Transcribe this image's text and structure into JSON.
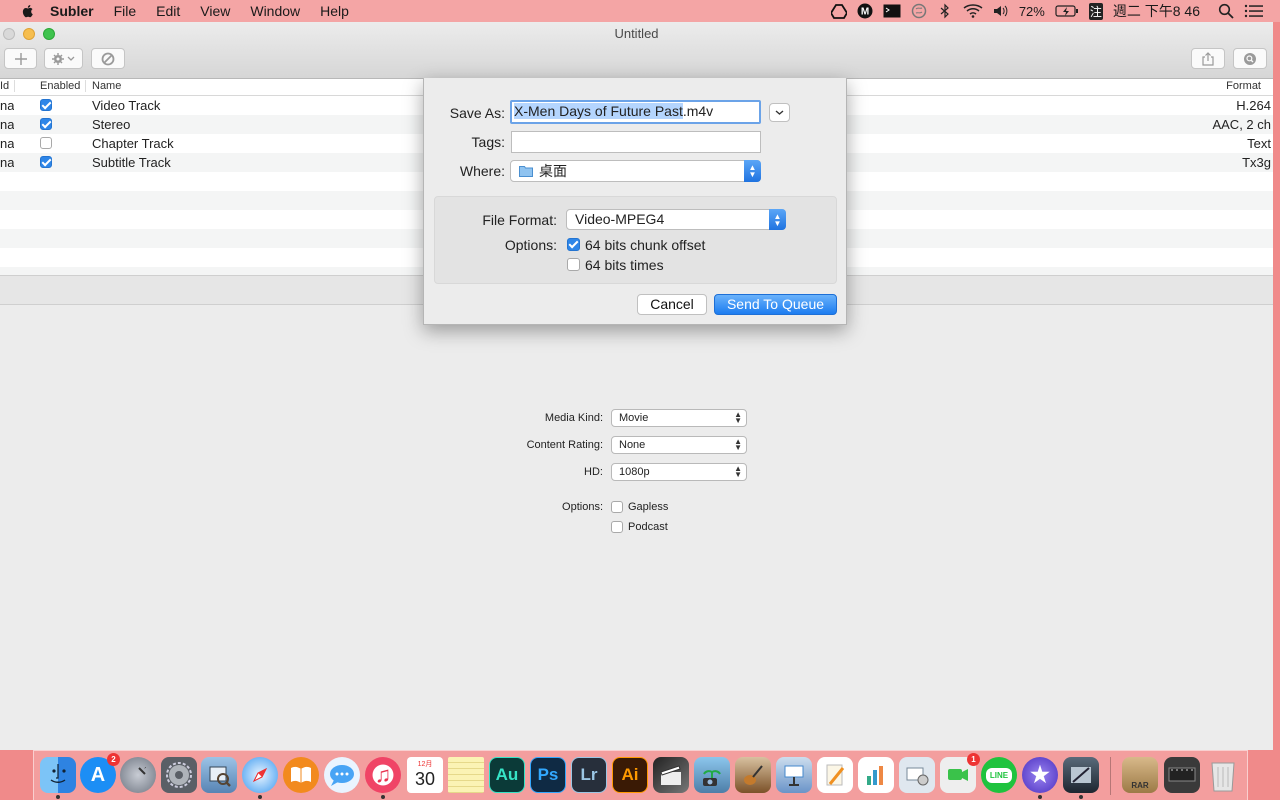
{
  "menubar": {
    "app_name": "Subler",
    "items": [
      "File",
      "Edit",
      "View",
      "Window",
      "Help"
    ],
    "battery": "72%",
    "input_method": "注",
    "clock": "週二 下午8 46"
  },
  "window": {
    "title": "Untitled"
  },
  "tracks": {
    "headers": {
      "id": "Id",
      "enabled": "Enabled",
      "name": "Name",
      "format": "Format"
    },
    "rows": [
      {
        "id": "na",
        "enabled": true,
        "name": "Video Track",
        "format": "H.264"
      },
      {
        "id": "na",
        "enabled": true,
        "name": "Stereo",
        "format": "AAC, 2 ch"
      },
      {
        "id": "na",
        "enabled": false,
        "name": "Chapter Track",
        "format": "Text"
      },
      {
        "id": "na",
        "enabled": true,
        "name": "Subtitle Track",
        "format": "Tx3g"
      }
    ]
  },
  "metadata": {
    "media_kind_label": "Media Kind:",
    "media_kind": "Movie",
    "content_rating_label": "Content Rating:",
    "content_rating": "None",
    "hd_label": "HD:",
    "hd": "1080p",
    "options_label": "Options:",
    "gapless": "Gapless",
    "podcast": "Podcast"
  },
  "save_sheet": {
    "save_as_label": "Save As:",
    "filename_selected": "X-Men Days of Future Past",
    "filename_ext": ".m4v",
    "tags_label": "Tags:",
    "tags_value": "",
    "where_label": "Where:",
    "where_value": "桌面",
    "file_format_label": "File Format:",
    "file_format": "Video-MPEG4",
    "options_label": "Options:",
    "opt_chunk": "64 bits chunk offset",
    "opt_chunk_checked": true,
    "opt_times": "64 bits times",
    "opt_times_checked": false,
    "cancel": "Cancel",
    "send": "Send To Queue"
  },
  "dock": {
    "app_store_badge": "2",
    "calendar_day": "30",
    "calendar_month": "12月",
    "facetime_badge": "1",
    "apps": [
      {
        "name": "Finder",
        "label": "",
        "color": "#3a8ee6"
      },
      {
        "name": "App Store",
        "label": "A",
        "color": "#2a8ff0"
      },
      {
        "name": "Launchpad",
        "label": "",
        "color": "#8a8f99"
      },
      {
        "name": "System Preferences",
        "label": "",
        "color": "#777"
      },
      {
        "name": "Preview",
        "label": "",
        "color": "#6b8fb5"
      },
      {
        "name": "Safari",
        "label": "",
        "color": "#3b9af0"
      },
      {
        "name": "iBooks",
        "label": "",
        "color": "#f08a24"
      },
      {
        "name": "Messages",
        "label": "",
        "color": "#4aa3f0"
      },
      {
        "name": "iTunes",
        "label": "♫",
        "color": "#ef3c5c"
      },
      {
        "name": "Calendar",
        "label": "",
        "color": "#ffffff"
      },
      {
        "name": "Notes",
        "label": "",
        "color": "#f5e27a"
      },
      {
        "name": "Audition",
        "label": "Au",
        "color": "#0c3b3a"
      },
      {
        "name": "Photoshop",
        "label": "Ps",
        "color": "#0f2a44"
      },
      {
        "name": "Lightroom",
        "label": "Lr",
        "color": "#2a3240"
      },
      {
        "name": "Illustrator",
        "label": "Ai",
        "color": "#3a1a05"
      },
      {
        "name": "Final Cut Pro",
        "label": "",
        "color": "#444"
      },
      {
        "name": "iPhoto",
        "label": "",
        "color": "#6fa8d8"
      },
      {
        "name": "GarageBand",
        "label": "",
        "color": "#8a5a2a"
      },
      {
        "name": "Keynote",
        "label": "",
        "color": "#3d7fd1"
      },
      {
        "name": "Pages",
        "label": "",
        "color": "#f0a030"
      },
      {
        "name": "Numbers",
        "label": "",
        "color": "#3aa84a"
      },
      {
        "name": "Image Capture",
        "label": "",
        "color": "#c8d8e8"
      },
      {
        "name": "FaceTime",
        "label": "",
        "color": "#3ac24a"
      },
      {
        "name": "LINE",
        "label": "LINE",
        "color": "#20c040"
      },
      {
        "name": "iMovie",
        "label": "★",
        "color": "#6a4ad0"
      },
      {
        "name": "Subler",
        "label": "",
        "color": "#2d3a4a"
      },
      {
        "name": "RAR",
        "label": "RAR",
        "color": "#b08850"
      },
      {
        "name": "Screen Recorder",
        "label": "",
        "color": "#333"
      },
      {
        "name": "Trash",
        "label": "",
        "color": "#d8d8d8"
      }
    ]
  }
}
